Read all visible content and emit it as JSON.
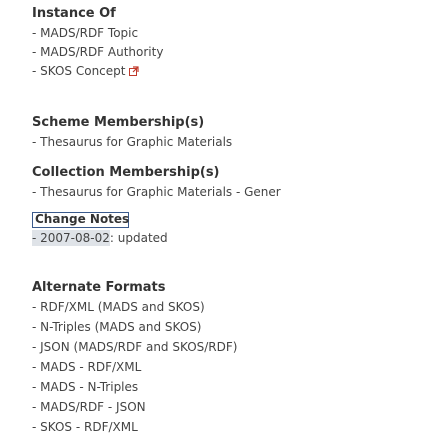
{
  "instance_of": {
    "heading": "Instance Of",
    "items": [
      "- MADS/RDF Topic",
      "- MADS/RDF Authority",
      "- SKOS Concept"
    ]
  },
  "scheme_membership": {
    "heading": "Scheme Membership(s)",
    "items": [
      "- Thesaurus for Graphic Materials"
    ]
  },
  "collection_membership": {
    "heading": "Collection Membership(s)",
    "items": [
      "- Thesaurus for Graphic Materials - Gener"
    ]
  },
  "change_notes": {
    "heading": "Change Notes",
    "date_part": "- 2007-08-02",
    "status_part": ": updated"
  },
  "alternate_formats": {
    "heading": "Alternate Formats",
    "items": [
      "- RDF/XML (MADS and SKOS)",
      "- N-Triples (MADS and SKOS)",
      "- JSON (MADS/RDF and SKOS/RDF)",
      "- MADS - RDF/XML",
      "- MADS - N-Triples",
      "- MADS/RDF - JSON",
      "- SKOS - RDF/XML"
    ]
  },
  "colors": {
    "text": "#333333",
    "link_icon": "#c0392b",
    "box_border": "#3a5a8c"
  },
  "icons": {
    "external_link": "external-link-icon"
  }
}
